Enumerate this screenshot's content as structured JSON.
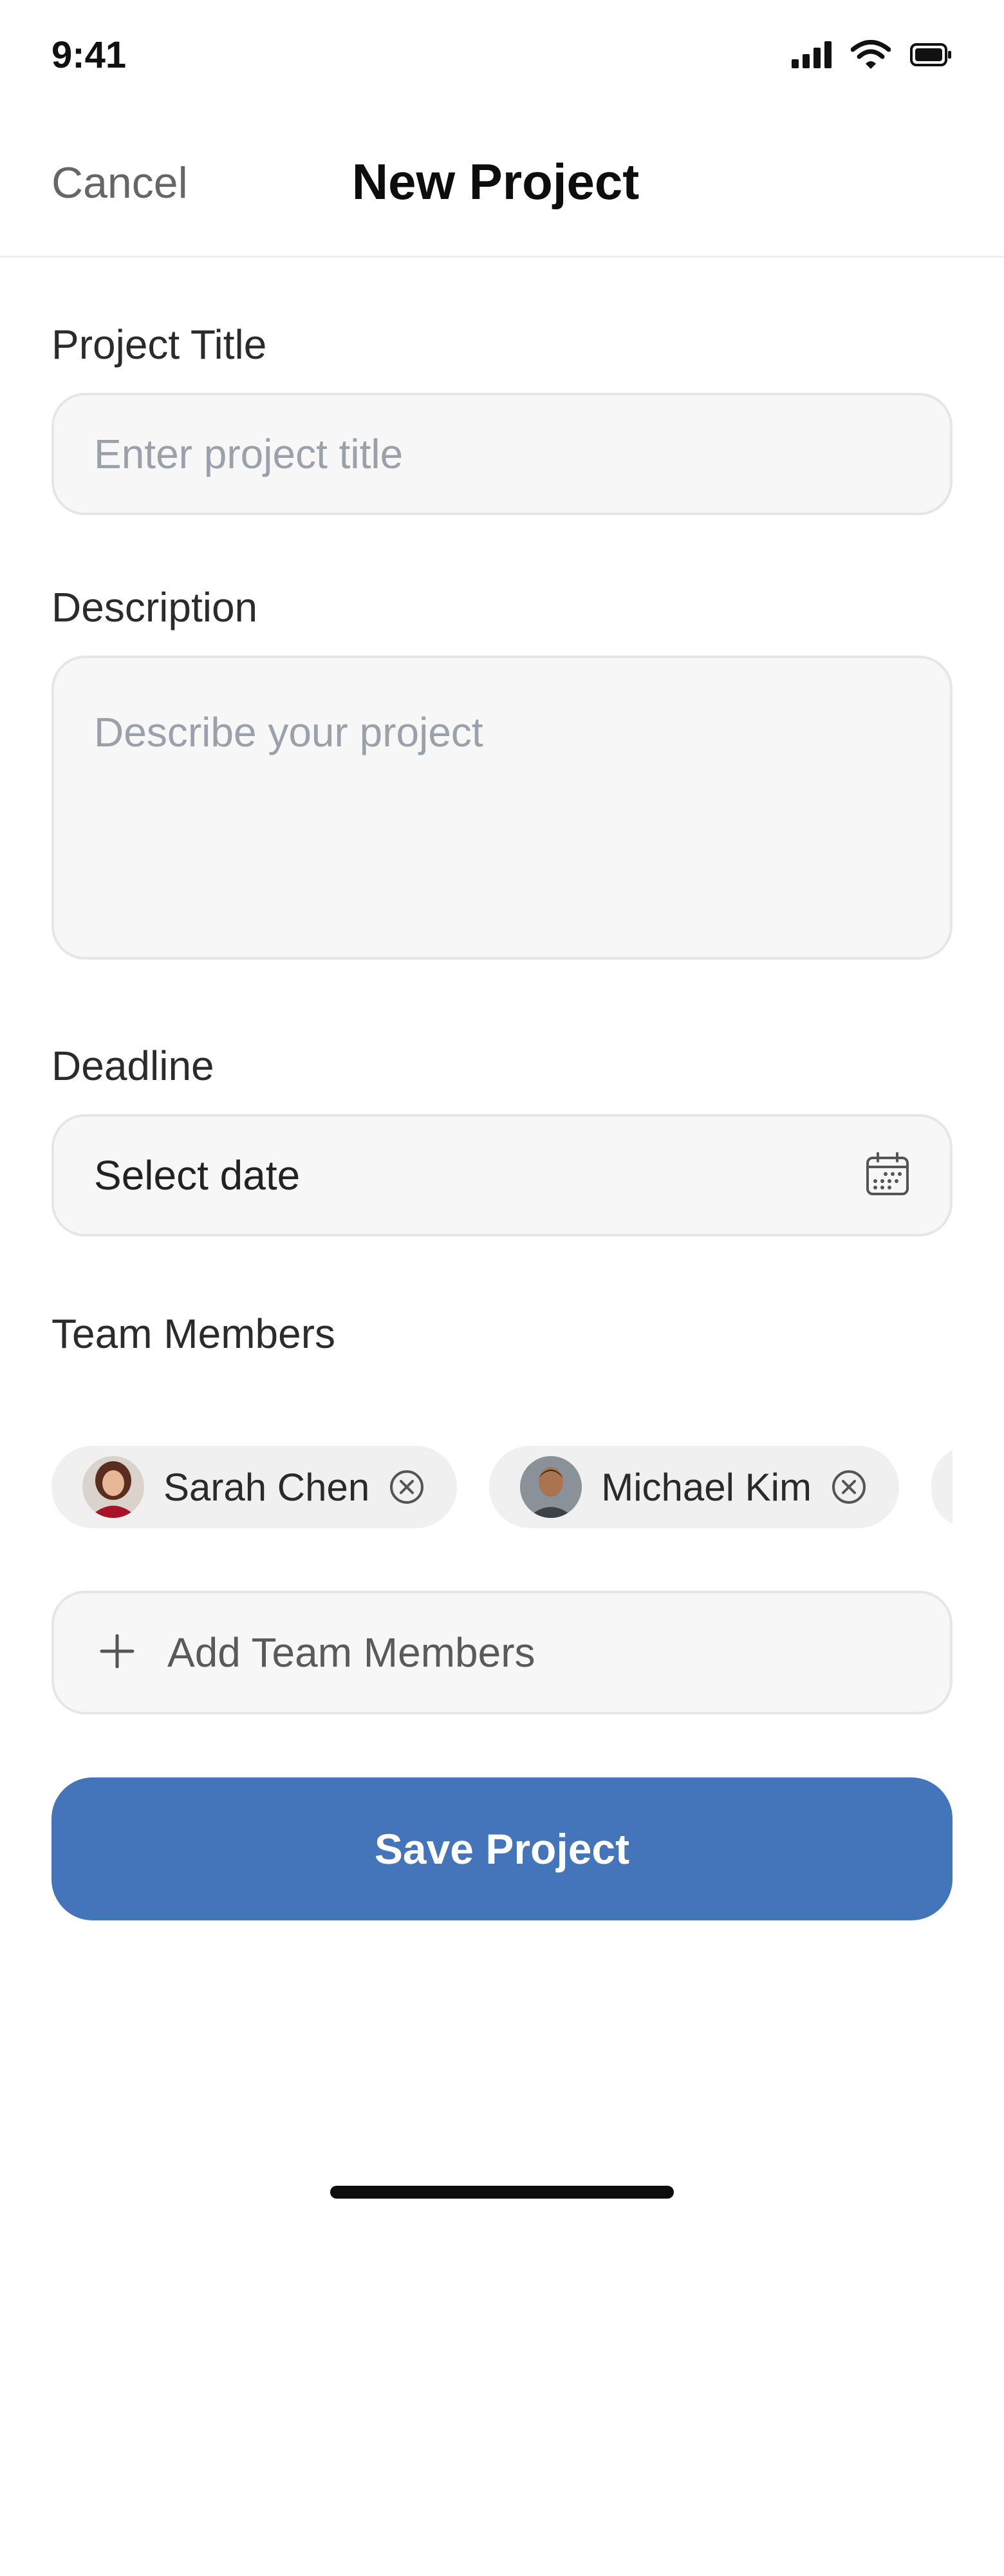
{
  "status_bar": {
    "time": "9:41"
  },
  "nav": {
    "cancel_label": "Cancel",
    "title": "New Project"
  },
  "form": {
    "title_label": "Project Title",
    "title_placeholder": "Enter project title",
    "title_value": "",
    "description_label": "Description",
    "description_placeholder": "Describe your project",
    "description_value": "",
    "deadline_label": "Deadline",
    "deadline_value": "Select date",
    "team_label": "Team Members",
    "members": [
      {
        "name": "Sarah Chen",
        "avatar": "avatar-sarah"
      },
      {
        "name": "Michael Kim",
        "avatar": "avatar-michael"
      }
    ],
    "add_members_label": "Add Team Members",
    "save_label": "Save Project"
  },
  "colors": {
    "primary": "#4474b9",
    "field_bg": "#f7f7f7",
    "chip_bg": "#f0f0f0",
    "placeholder": "#9aa1ab"
  }
}
